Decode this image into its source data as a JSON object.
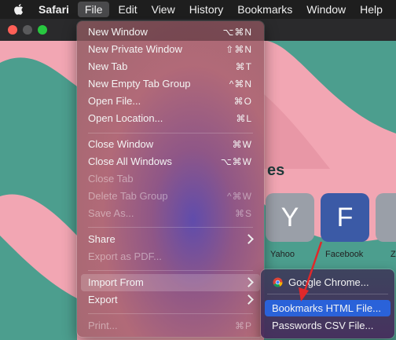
{
  "menubar": {
    "apple_icon": "apple-logo-icon",
    "app_name": "Safari",
    "items": [
      "File",
      "Edit",
      "View",
      "History",
      "Bookmarks",
      "Window",
      "Help"
    ]
  },
  "favorites": {
    "title_fragment": "es",
    "tiles": [
      {
        "letter": "Y",
        "label": "Yahoo",
        "color": "#9a9fa8",
        "text_color": "#ffffff"
      },
      {
        "letter": "F",
        "label": "Facebook",
        "color": "#3b5aa6",
        "text_color": "#ffffff"
      },
      {
        "letter": "",
        "label": "Z",
        "color": "#9a9fa8",
        "text_color": "#ffffff"
      }
    ]
  },
  "file_menu": {
    "items": [
      {
        "label": "New Window",
        "shortcut": "⌥⌘N"
      },
      {
        "label": "New Private Window",
        "shortcut": "⇧⌘N"
      },
      {
        "label": "New Tab",
        "shortcut": "⌘T"
      },
      {
        "label": "New Empty Tab Group",
        "shortcut": "^⌘N"
      },
      {
        "label": "Open File...",
        "shortcut": "⌘O"
      },
      {
        "label": "Open Location...",
        "shortcut": "⌘L"
      },
      {
        "label": "Close Window",
        "shortcut": "⌘W"
      },
      {
        "label": "Close All Windows",
        "shortcut": "⌥⌘W"
      },
      {
        "label": "Close Tab",
        "shortcut": ""
      },
      {
        "label": "Delete Tab Group",
        "shortcut": "^⌘W"
      },
      {
        "label": "Save As...",
        "shortcut": "⌘S"
      },
      {
        "label": "Share",
        "shortcut": ""
      },
      {
        "label": "Export as PDF...",
        "shortcut": ""
      },
      {
        "label": "Import From",
        "shortcut": ""
      },
      {
        "label": "Export",
        "shortcut": ""
      },
      {
        "label": "Print...",
        "shortcut": "⌘P"
      }
    ]
  },
  "import_submenu": {
    "items": [
      {
        "label": "Google Chrome..."
      },
      {
        "label": "Bookmarks HTML File..."
      },
      {
        "label": "Passwords CSV File..."
      }
    ]
  },
  "colors": {
    "accent": "#2a62d9",
    "annotation_arrow": "#e0282a",
    "background_pink": "#f2a6b3",
    "background_teal": "#4c9e8e"
  }
}
